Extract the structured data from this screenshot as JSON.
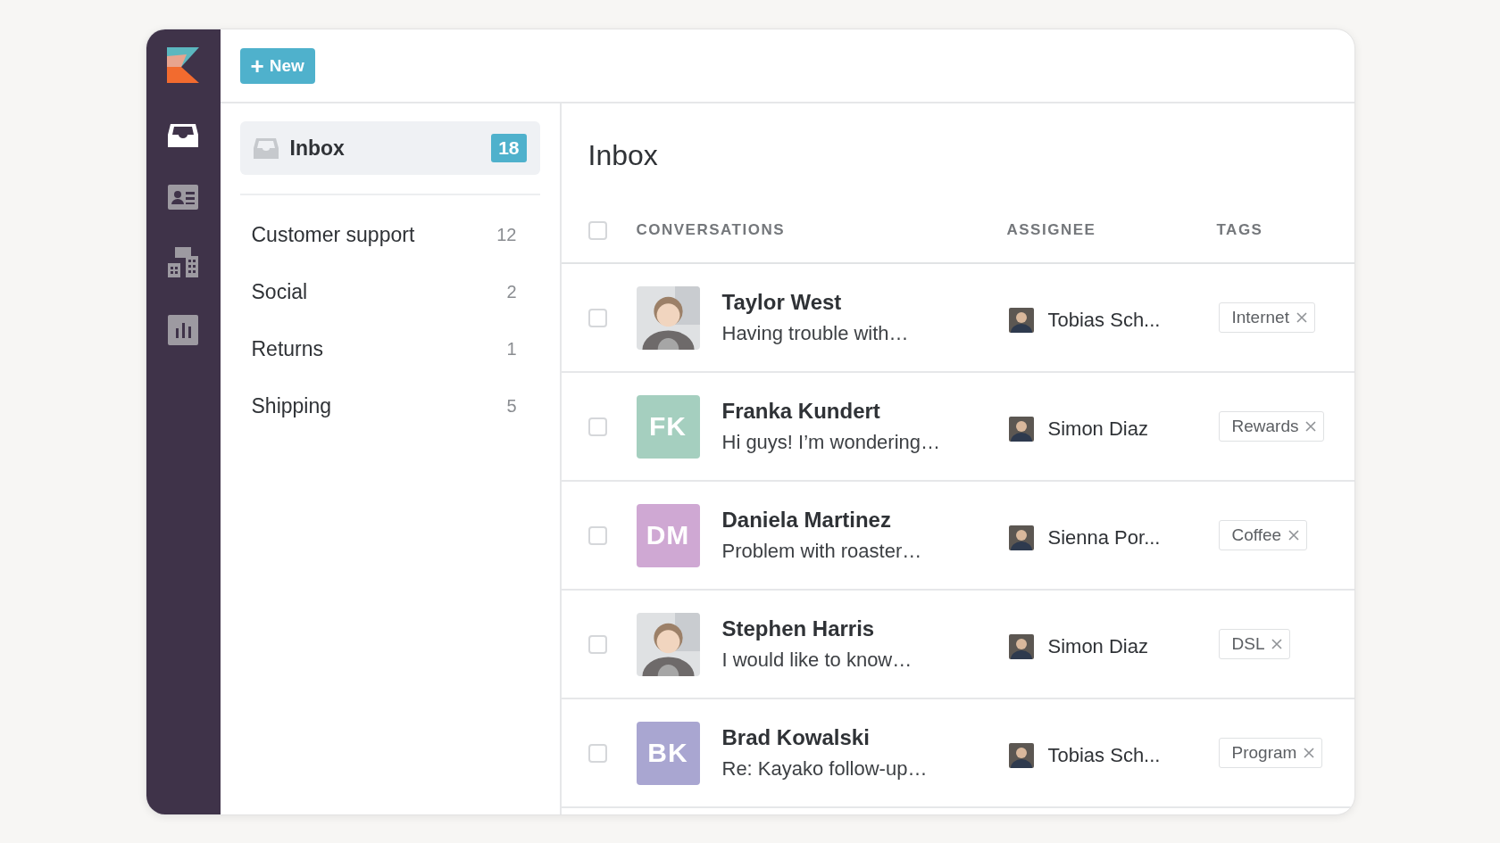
{
  "nav": [
    {
      "selected": true
    },
    {
      "selected": false
    },
    {
      "selected": false
    },
    {
      "selected": false
    }
  ],
  "new_button": {
    "icon": "+",
    "label": "New"
  },
  "folders": {
    "inbox": {
      "label": "Inbox",
      "count": "18",
      "selected": true
    },
    "items": [
      {
        "label": "Customer support",
        "count": "12",
        "selected": false
      },
      {
        "label": "Social",
        "count": "2",
        "selected": false
      },
      {
        "label": "Returns",
        "count": "1",
        "selected": false
      },
      {
        "label": "Shipping",
        "count": "5",
        "selected": false
      }
    ]
  },
  "title": "Inbox",
  "table": {
    "select_all": {
      "checked": false
    },
    "columns": [
      "CONVERSATIONS",
      "ASSIGNEE",
      "TAGS"
    ],
    "rows": [
      {
        "checked": false,
        "name": "Taylor West",
        "preview": "Having trouble with…",
        "assignee": "Tobias Sch...",
        "tag": "Internet"
      },
      {
        "checked": false,
        "avatar": {
          "kind": "initials",
          "initials": "FK",
          "color": "#a5cfbf"
        },
        "name": "Franka Kundert",
        "preview": "Hi guys! I’m wondering…",
        "assignee": "Simon Diaz",
        "tag": "Rewards"
      },
      {
        "checked": false,
        "avatar": {
          "kind": "initials",
          "initials": "DM",
          "color": "#cfa8d3"
        },
        "name": "Daniela Martinez",
        "preview": "Problem with roaster…",
        "assignee": "Sienna Por...",
        "tag": "Coffee"
      },
      {
        "checked": false,
        "name": "Stephen Harris",
        "preview": "I would like to know…",
        "assignee": "Simon Diaz",
        "tag": "DSL"
      },
      {
        "checked": false,
        "avatar": {
          "kind": "initials",
          "initials": "BK",
          "color": "#a9a6d1"
        },
        "name": "Brad Kowalski",
        "preview": "Re: Kayako follow-up…",
        "assignee": "Tobias Sch...",
        "tag": "Program"
      }
    ]
  }
}
